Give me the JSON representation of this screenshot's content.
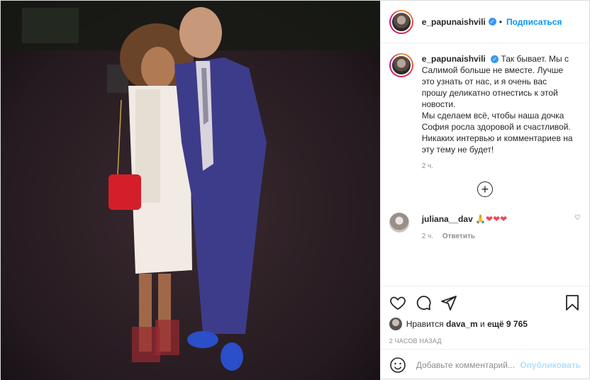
{
  "post": {
    "username": "e_papunaishvili",
    "follow_label": "Подписаться",
    "caption": "Так бывает. Мы с Салимой больше не вместе. Лучше это узнать от нас, и я очень вас прошу деликатно отнестись к этой новости.",
    "caption_p2": "Мы сделаем всё, чтобы наша дочка София росла здоровой и счастливой.",
    "caption_p3": "Никаких интервью и комментариев на эту тему не будет!",
    "caption_time": "2 ч.",
    "colors": {
      "accent": "#0095f6",
      "verified": "#3897f0",
      "heart": "#ed4956"
    }
  },
  "comment": {
    "username": "juliana__dav",
    "emoji": "🙏",
    "hearts": "❤❤❤",
    "time": "2 ч.",
    "reply_label": "Ответить"
  },
  "likes": {
    "prefix": "Нравится",
    "user": "dava_m",
    "conj": "и",
    "more": "ещё 9 765"
  },
  "posted_ago": "2 ЧАСОВ НАЗАД",
  "add_comment": {
    "placeholder": "Добавьте комментарий...",
    "publish_label": "Опубликовать"
  }
}
